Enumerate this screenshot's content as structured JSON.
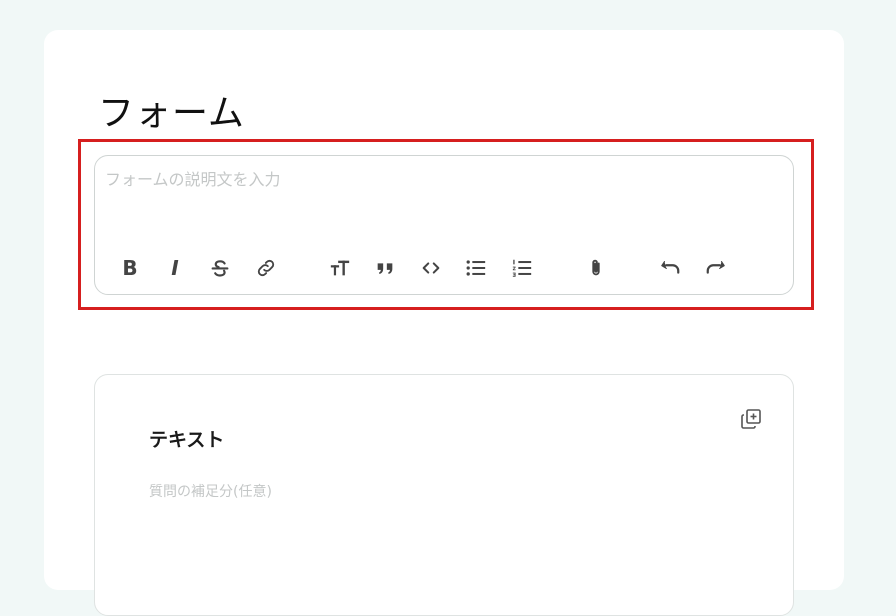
{
  "form": {
    "title": "フォーム",
    "description_placeholder": "フォームの説明文を入力"
  },
  "toolbar": {
    "buttons": [
      {
        "name": "bold",
        "icon": "bold-icon",
        "glyph": "B"
      },
      {
        "name": "italic",
        "icon": "italic-icon",
        "glyph": "I"
      },
      {
        "name": "strikethrough",
        "icon": "strikethrough-icon"
      },
      {
        "name": "link",
        "icon": "link-icon"
      },
      {
        "name": "heading",
        "icon": "text-size-icon"
      },
      {
        "name": "quote",
        "icon": "quote-icon"
      },
      {
        "name": "code",
        "icon": "code-icon"
      },
      {
        "name": "bullet-list",
        "icon": "bullet-list-icon"
      },
      {
        "name": "numbered-list",
        "icon": "numbered-list-icon"
      },
      {
        "name": "attach",
        "icon": "paperclip-icon"
      },
      {
        "name": "undo",
        "icon": "undo-icon"
      },
      {
        "name": "redo",
        "icon": "redo-icon"
      }
    ]
  },
  "question": {
    "title": "テキスト",
    "supplement_placeholder": "質問の補足分(任意)",
    "duplicate_icon": "duplicate-icon"
  },
  "colors": {
    "highlight": "#d61f1f",
    "background": "#f1f8f7",
    "icon": "#444444",
    "placeholder": "#c4c7c7"
  }
}
